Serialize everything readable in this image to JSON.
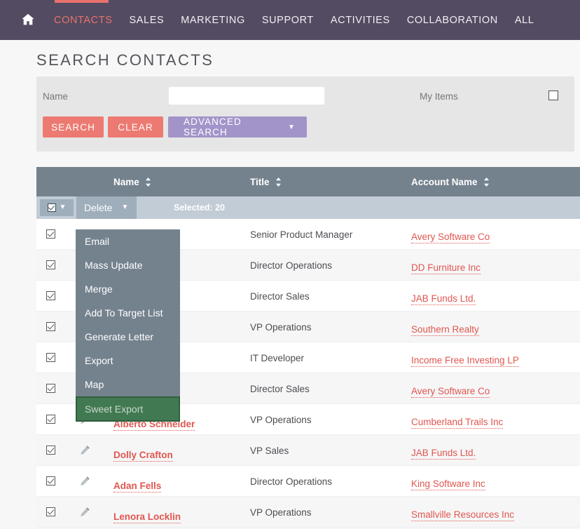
{
  "topnav": {
    "home_icon": "home-icon",
    "items": [
      {
        "label": "CONTACTS",
        "active": true
      },
      {
        "label": "SALES",
        "active": false
      },
      {
        "label": "MARKETING",
        "active": false
      },
      {
        "label": "SUPPORT",
        "active": false
      },
      {
        "label": "ACTIVITIES",
        "active": false
      },
      {
        "label": "COLLABORATION",
        "active": false
      },
      {
        "label": "ALL",
        "active": false
      }
    ],
    "active_color": "#e8736c",
    "background": "#534b61"
  },
  "sidebar_toggle": {
    "icon": "play-triangle-icon"
  },
  "page": {
    "title": "SEARCH CONTACTS"
  },
  "search": {
    "name_label": "Name",
    "name_value": "",
    "name_placeholder": "",
    "my_items_label": "My Items",
    "my_items_checked": false,
    "buttons": {
      "search": "SEARCH",
      "clear": "CLEAR",
      "advanced": "ADVANCED SEARCH",
      "advanced_caret": "▼"
    },
    "colors": {
      "primary_button": "#ec7a72",
      "advanced_button": "#a294c9",
      "panel": "#e6e6e6"
    }
  },
  "table": {
    "headers": [
      {
        "label": "Name",
        "sort_icon": "sort-updown-icon"
      },
      {
        "label": "Title",
        "sort_icon": "sort-updown-icon"
      },
      {
        "label": "Account Name",
        "sort_icon": "sort-updown-icon"
      }
    ],
    "header_background": "#74828e",
    "actionbar": {
      "select_all_checked": true,
      "select_all_caret": "▼",
      "bulk_action_label": "Delete",
      "bulk_action_caret": "▼",
      "selected_text": "Selected: 20"
    },
    "rows": [
      {
        "name": "",
        "title": "Senior Product Manager",
        "account": "Avery Software Co",
        "checked": true
      },
      {
        "name": "",
        "title": "Director Operations",
        "account": "DD Furniture Inc",
        "checked": true
      },
      {
        "name": "",
        "title": "Director Sales",
        "account": "JAB Funds Ltd.",
        "checked": true
      },
      {
        "name": "",
        "title": "VP Operations",
        "account": "Southern Realty",
        "checked": true
      },
      {
        "name": "",
        "title": "IT Developer",
        "account": "Income Free Investing LP",
        "checked": true
      },
      {
        "name": "",
        "title": "Director Sales",
        "account": "Avery Software Co",
        "checked": true
      },
      {
        "name": "Alberto Schneider",
        "title": "VP Operations",
        "account": "Cumberland Trails Inc",
        "checked": true
      },
      {
        "name": "Dolly Crafton",
        "title": "VP Sales",
        "account": "JAB Funds Ltd.",
        "checked": true
      },
      {
        "name": "Adan Fells",
        "title": "Director Operations",
        "account": "King Software Inc",
        "checked": true
      },
      {
        "name": "Lenora Locklin",
        "title": "VP Operations",
        "account": "Smallville Resources Inc",
        "checked": true
      }
    ],
    "link_color": "#e0564f"
  },
  "dropdown": {
    "background": "#74828e",
    "highlight_background": "#417a52",
    "items": [
      {
        "label": "Email",
        "highlight": false
      },
      {
        "label": "Mass Update",
        "highlight": false
      },
      {
        "label": "Merge",
        "highlight": false
      },
      {
        "label": "Add To Target List",
        "highlight": false
      },
      {
        "label": "Generate Letter",
        "highlight": false
      },
      {
        "label": "Export",
        "highlight": false
      },
      {
        "label": "Map",
        "highlight": false
      },
      {
        "label": "Sweet Export",
        "highlight": true
      }
    ]
  }
}
